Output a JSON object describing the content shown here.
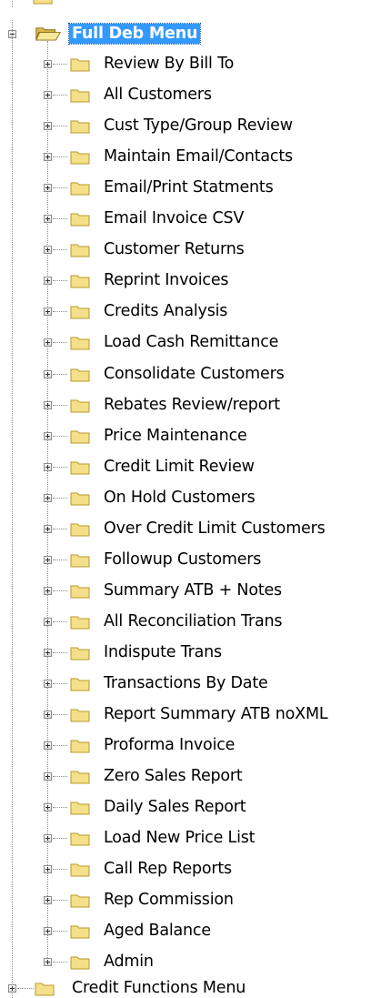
{
  "tree": {
    "root": {
      "label": "Full Deb Menu",
      "selected": true,
      "expanded": true
    },
    "items": [
      "Review By Bill To",
      "All Customers",
      "Cust Type/Group Review",
      "Maintain Email/Contacts",
      "Email/Print Statments",
      "Email Invoice CSV",
      "Customer Returns",
      "Reprint Invoices",
      "Credits Analysis",
      "Load Cash Remittance",
      "Consolidate Customers",
      "Rebates Review/report",
      "Price Maintenance",
      "Credit Limit Review",
      "On Hold Customers",
      "Over Credit Limit Customers",
      "Followup Customers",
      "Summary ATB + Notes",
      "All Reconciliation Trans",
      "Indispute Trans",
      "Transactions By Date",
      "Report Summary ATB noXML",
      "Proforma Invoice",
      "Zero Sales Report",
      "Daily Sales Report",
      "Load New Price List",
      "Call Rep Reports",
      "Rep Commission",
      "Aged Balance",
      "Admin"
    ],
    "next_sibling": {
      "label": "Credit Functions Menu"
    }
  },
  "colors": {
    "selection": "#3399ff",
    "folder_body": "#f4e08a",
    "folder_edge": "#b89a2a"
  },
  "icons": {
    "folder": "folder-icon",
    "expand": "plus-expander-icon",
    "collapse": "minus-expander-icon"
  }
}
